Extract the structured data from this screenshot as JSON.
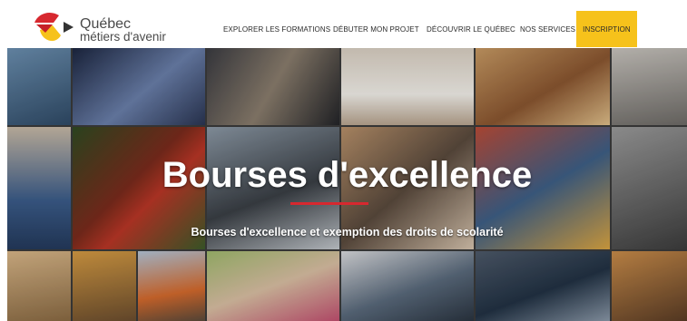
{
  "brand": {
    "line1": "Québec",
    "line2": "métiers d'avenir",
    "colors": {
      "red": "#d7282f",
      "yellow": "#f6c21b",
      "dark": "#333333"
    }
  },
  "nav": {
    "items": [
      {
        "label": "EXPLORER LES FORMATIONS"
      },
      {
        "label": "DÉBUTER MON PROJET"
      },
      {
        "label": "DÉCOUVRIR LE QUÉBEC"
      },
      {
        "label": "NOS SERVICES"
      }
    ],
    "cta": {
      "label": "INSCRIPTION",
      "color": "#f6c21b"
    }
  },
  "hero": {
    "title": "Bourses d'excellence",
    "subtitle": "Bourses d'excellence et exemption des droits de scolarité",
    "accent_color": "#d7282f"
  }
}
